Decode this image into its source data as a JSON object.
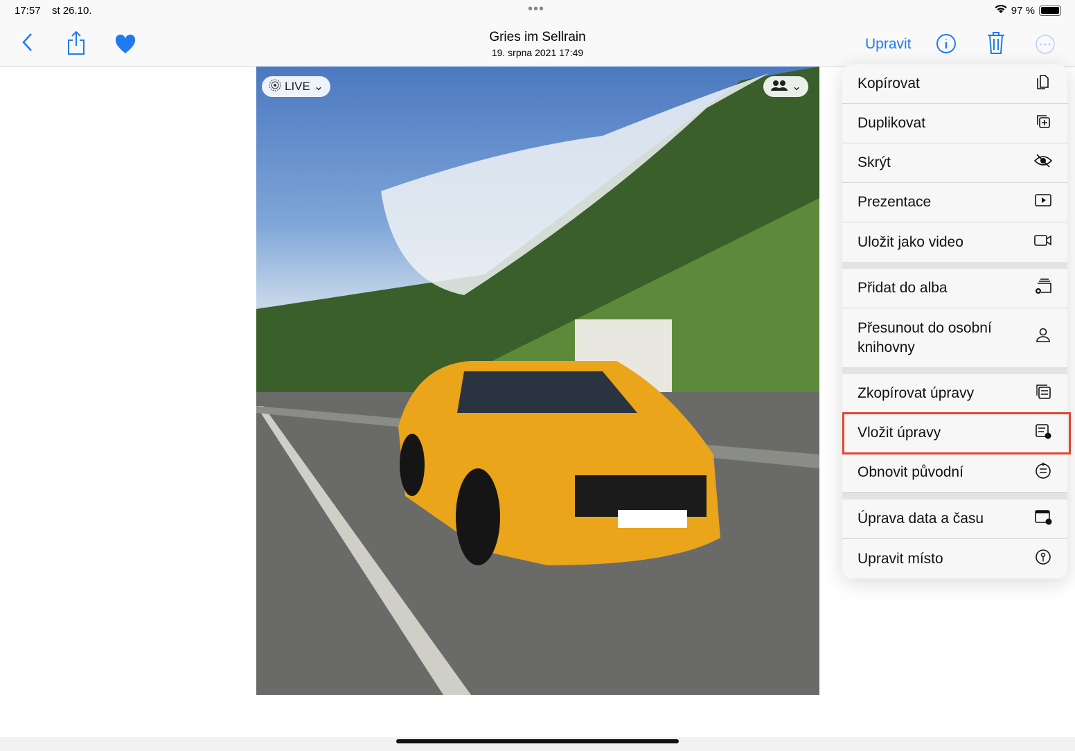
{
  "status": {
    "time": "17:57",
    "date": "st 26.10.",
    "battery": "97 %",
    "battery_level": 0.97
  },
  "nav": {
    "title": "Gries im Sellrain",
    "subtitle": "19. srpna 2021  17:49",
    "edit": "Upravit"
  },
  "photo": {
    "live": "LIVE"
  },
  "menu": {
    "groups": [
      [
        {
          "label": "Kopírovat",
          "icon": "copy-icon"
        },
        {
          "label": "Duplikovat",
          "icon": "duplicate-icon"
        },
        {
          "label": "Skrýt",
          "icon": "eye-slash-icon"
        },
        {
          "label": "Prezentace",
          "icon": "play-rectangle-icon"
        },
        {
          "label": "Uložit jako video",
          "icon": "video-icon"
        }
      ],
      [
        {
          "label": "Přidat do alba",
          "icon": "add-to-album-icon"
        },
        {
          "label": "Přesunout do osobní knihovny",
          "icon": "person-icon"
        }
      ],
      [
        {
          "label": "Zkopírovat úpravy",
          "icon": "copy-adjustments-icon"
        },
        {
          "label": "Vložit úpravy",
          "icon": "paste-adjustments-icon",
          "highlighted": true
        },
        {
          "label": "Obnovit původní",
          "icon": "revert-icon"
        }
      ],
      [
        {
          "label": "Úprava data a času",
          "icon": "calendar-clock-icon"
        },
        {
          "label": "Upravit místo",
          "icon": "location-icon"
        }
      ]
    ]
  },
  "colors": {
    "accent": "#1f7aef",
    "highlight": "#e4432e"
  }
}
